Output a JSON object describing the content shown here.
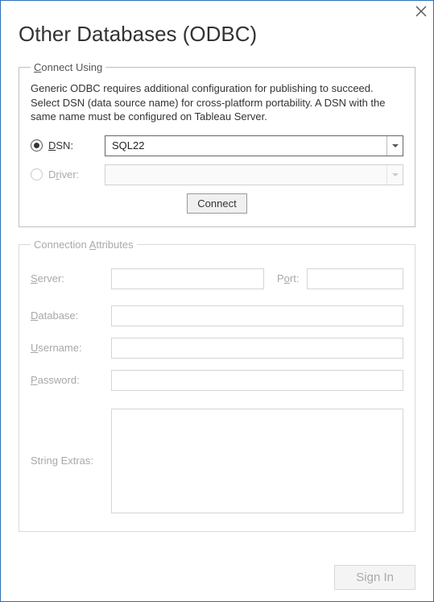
{
  "title": "Other Databases (ODBC)",
  "connect_using": {
    "legend": "Connect Using",
    "info_text": "Generic ODBC requires additional configuration for publishing to succeed. Select DSN (data source name) for cross-platform portability. A DSN with the same name must be configured on Tableau Server.",
    "dsn": {
      "label": "DSN:",
      "selected": true,
      "value": "SQL22"
    },
    "driver": {
      "label": "Driver:",
      "selected": false,
      "value": ""
    },
    "connect_button": "Connect"
  },
  "connection_attributes": {
    "legend": "Connection Attributes",
    "server_label": "Server:",
    "server_value": "",
    "port_label": "Port:",
    "port_value": "",
    "database_label": "Database:",
    "database_value": "",
    "username_label": "Username:",
    "username_value": "",
    "password_label": "Password:",
    "password_value": "",
    "string_extras_label": "String Extras:",
    "string_extras_value": ""
  },
  "signin_button": "Sign In"
}
